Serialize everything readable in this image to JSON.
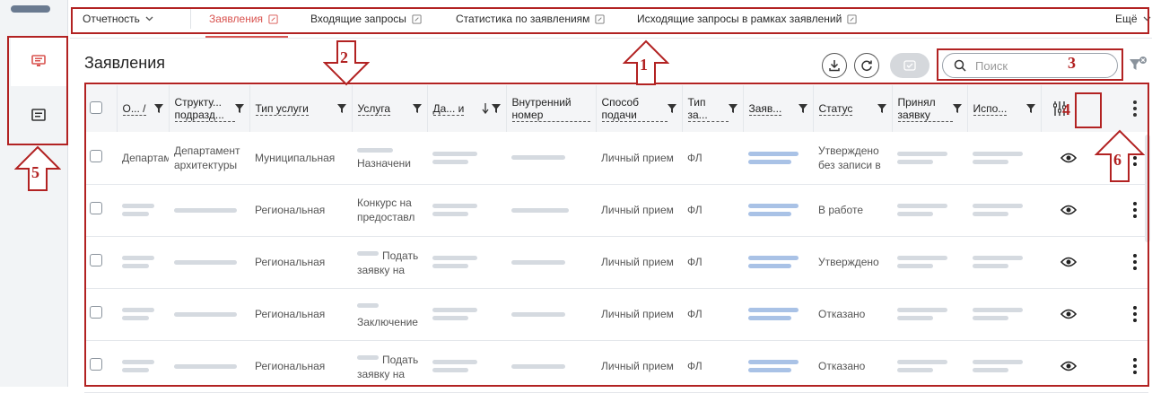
{
  "nav": {
    "dropdown_label": "Отчетность",
    "items": [
      {
        "label": "Заявления",
        "active": true
      },
      {
        "label": "Входящие запросы",
        "active": false
      },
      {
        "label": "Статистика по заявлениям",
        "active": false
      },
      {
        "label": "Исходящие запросы в рамках заявлений",
        "active": false
      }
    ],
    "more_label": "Ещё"
  },
  "page": {
    "title": "Заявления"
  },
  "search": {
    "placeholder": "Поиск"
  },
  "table": {
    "headers": [
      "О... /",
      "Структу... подразд...",
      "Тип услуги",
      "Услуга",
      "Да... и",
      "Внутренний номер",
      "Способ подачи",
      "Тип за...",
      "Заяв...",
      "Статус",
      "Принял заявку",
      "Испо..."
    ],
    "rows": [
      {
        "col1": "Департамент",
        "col2": "Департамент архитектуры",
        "type": "Муниципальная",
        "service": "Назначени",
        "method": "Личный прием",
        "applicant_type": "ФЛ",
        "status": "Утверждено без записи в"
      },
      {
        "col1": "",
        "col2": "",
        "type": "Региональная",
        "service": "Конкурс на предоставл",
        "method": "Личный прием",
        "applicant_type": "ФЛ",
        "status": "В работе"
      },
      {
        "col1": "",
        "col2": "",
        "type": "Региональная",
        "service": "Подать заявку на",
        "method": "Личный прием",
        "applicant_type": "ФЛ",
        "status": "Утверждено"
      },
      {
        "col1": "",
        "col2": "",
        "type": "Региональная",
        "service": "Заключение",
        "method": "Личный прием",
        "applicant_type": "ФЛ",
        "status": "Отказано"
      },
      {
        "col1": "",
        "col2": "",
        "type": "Региональная",
        "service": "Подать заявку на",
        "method": "Личный прием",
        "applicant_type": "ФЛ",
        "status": "Отказано"
      }
    ]
  },
  "annotations": [
    "1",
    "2",
    "3",
    "4",
    "5",
    "6"
  ],
  "colors": {
    "accent": "#d9534f",
    "annotation": "#b22222",
    "link": "#2a6ebb"
  },
  "icons": [
    "monitor-icon",
    "list-card-icon",
    "download-icon",
    "refresh-icon",
    "check-icon",
    "search-icon",
    "filter-clear-icon",
    "filter-icon",
    "column-settings-icon",
    "more-vertical-icon",
    "eye-icon",
    "pencil-icon",
    "chevron-down-icon",
    "sort-down-icon"
  ]
}
